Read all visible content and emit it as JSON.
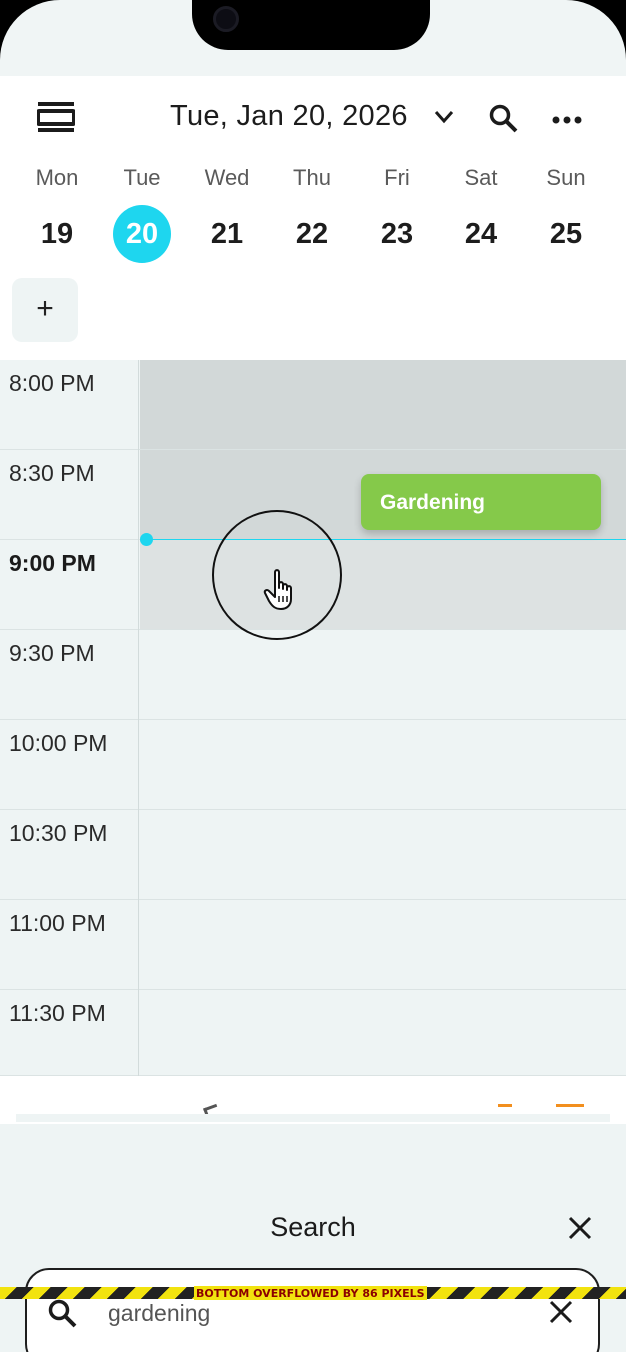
{
  "header": {
    "date_title": "Tue, Jan 20, 2026"
  },
  "week": [
    {
      "name": "Mon",
      "num": "19"
    },
    {
      "name": "Tue",
      "num": "20",
      "selected": true
    },
    {
      "name": "Wed",
      "num": "21"
    },
    {
      "name": "Thu",
      "num": "22"
    },
    {
      "name": "Fri",
      "num": "23"
    },
    {
      "name": "Sat",
      "num": "24"
    },
    {
      "name": "Sun",
      "num": "25"
    }
  ],
  "add_button": "+",
  "times": [
    "8:00 PM",
    "8:30 PM",
    "9:00 PM",
    "9:30 PM",
    "10:00 PM",
    "10:30 PM",
    "11:00 PM",
    "11:30 PM"
  ],
  "event": {
    "title": "Gardening",
    "color": "#85c94a"
  },
  "colors": {
    "accent": "#1ed6ef"
  },
  "search_sheet": {
    "title": "Search",
    "query": "gardening"
  },
  "debug": {
    "overflow_message": "BOTTOM OVERFLOWED BY 86 PIXELS"
  },
  "icons": [
    "menu-icon",
    "chevron-down-icon",
    "search-icon",
    "more-icon",
    "hand-cursor-icon",
    "close-icon",
    "clear-icon"
  ]
}
